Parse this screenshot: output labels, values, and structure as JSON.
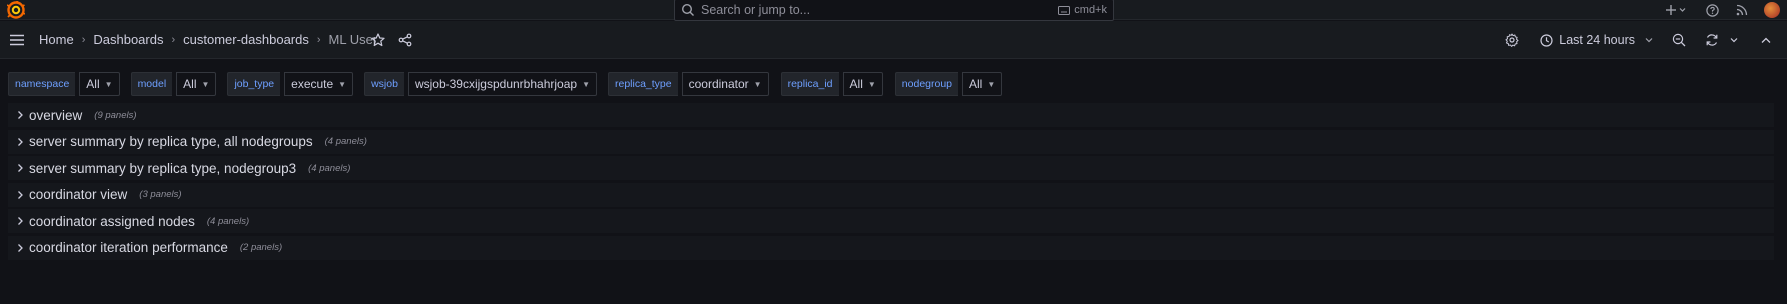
{
  "topbar": {
    "search_placeholder": "Search or jump to...",
    "search_shortcut": "cmd+k",
    "icons": [
      "grafana-logo-icon",
      "plus-icon",
      "help-icon",
      "rss-icon",
      "avatar"
    ]
  },
  "breadcrumb": {
    "items": [
      "Home",
      "Dashboards",
      "customer-dashboards",
      "ML User"
    ]
  },
  "time_picker": {
    "label": "Last 24 hours"
  },
  "variables": [
    {
      "label": "namespace",
      "value": "All"
    },
    {
      "label": "model",
      "value": "All"
    },
    {
      "label": "job_type",
      "value": "execute"
    },
    {
      "label": "wsjob",
      "value": "wsjob-39cxijgspdunrbhahrjoap"
    },
    {
      "label": "replica_type",
      "value": "coordinator"
    },
    {
      "label": "replica_id",
      "value": "All"
    },
    {
      "label": "nodegroup",
      "value": "All"
    }
  ],
  "rows": [
    {
      "title": "overview",
      "count": "(9 panels)"
    },
    {
      "title": "server summary by replica type, all nodegroups",
      "count": "(4 panels)"
    },
    {
      "title": "server summary by replica type, nodegroup3",
      "count": "(4 panels)"
    },
    {
      "title": "coordinator view",
      "count": "(3 panels)"
    },
    {
      "title": "coordinator assigned nodes",
      "count": "(4 panels)"
    },
    {
      "title": "coordinator iteration performance",
      "count": "(2 panels)"
    }
  ],
  "colors": {
    "background": "#111217",
    "bar": "#181b1f",
    "variable_label": "#6e9fff",
    "logo": "#f46800"
  }
}
